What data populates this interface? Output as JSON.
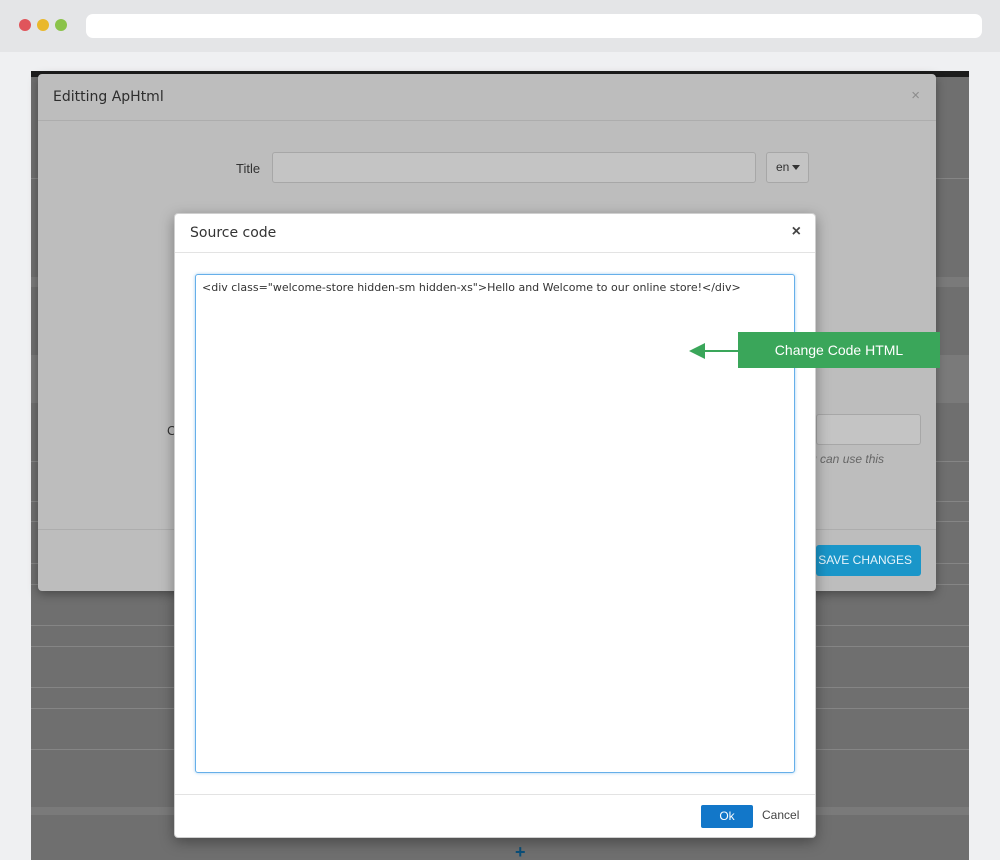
{
  "edit_modal": {
    "title": "Editting ApHtml",
    "close": "×",
    "title_label": "Title",
    "title_value": "",
    "lang": "en",
    "partial_label": "C",
    "help_text": "u can use this",
    "save_label": "SAVE CHANGES"
  },
  "source_modal": {
    "title": "Source code",
    "close": "×",
    "code": "<div class=\"welcome-store hidden-sm hidden-xs\">Hello and Welcome to our online store!</div>",
    "ok_label": "Ok",
    "cancel_label": "Cancel"
  },
  "annotation": {
    "label": "Change Code HTML"
  },
  "app": {
    "add_icon": "+"
  },
  "colors": {
    "accent": "#3aa65a",
    "primary": "#1277c9",
    "save": "#1a96c9"
  }
}
